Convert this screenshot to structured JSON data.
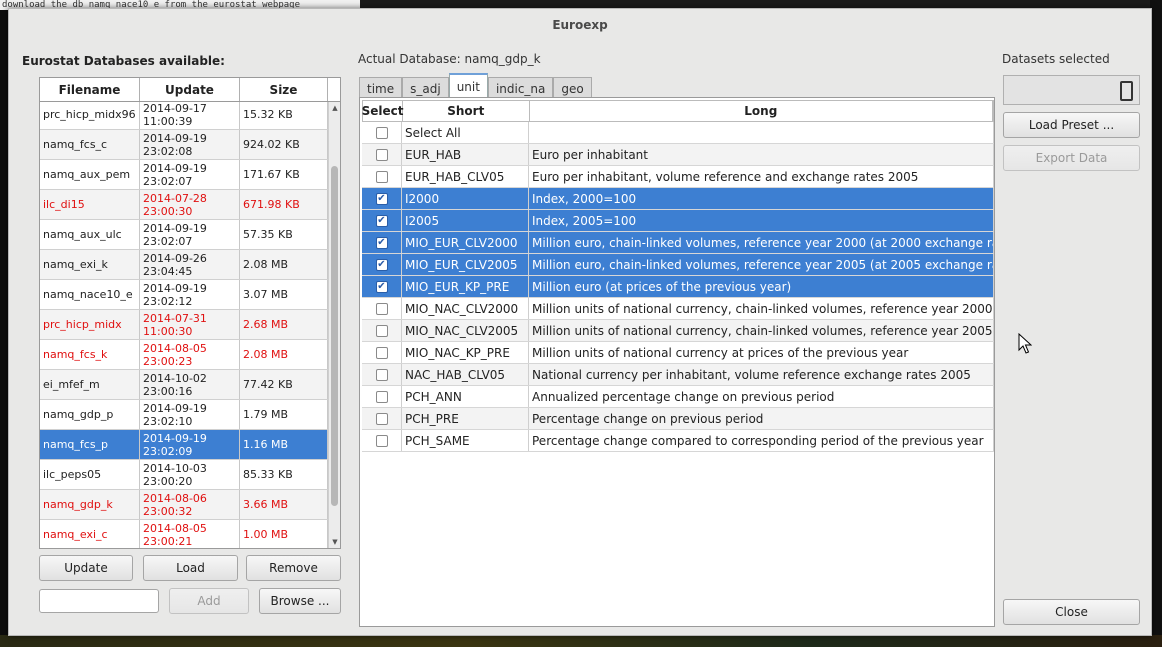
{
  "background": {
    "terminal_line": "download the db namq_nace10_e from the eurostat webpage"
  },
  "window": {
    "title": "Euroexp"
  },
  "left_panel": {
    "heading": "Eurostat Databases available:",
    "columns": [
      "Filename",
      "Update",
      "Size"
    ],
    "rows": [
      {
        "name": "prc_hicp_midx96",
        "date": "2014-09-17",
        "time": "11:00:39",
        "size": "15.32 KB",
        "state": "normal"
      },
      {
        "name": "namq_fcs_c",
        "date": "2014-09-19",
        "time": "23:02:08",
        "size": "924.02 KB",
        "state": "normal"
      },
      {
        "name": "namq_aux_pem",
        "date": "2014-09-19",
        "time": "23:02:07",
        "size": "171.67 KB",
        "state": "normal"
      },
      {
        "name": "ilc_di15",
        "date": "2014-07-28",
        "time": "23:00:30",
        "size": "671.98 KB",
        "state": "red"
      },
      {
        "name": "namq_aux_ulc",
        "date": "2014-09-19",
        "time": "23:02:07",
        "size": "57.35 KB",
        "state": "normal"
      },
      {
        "name": "namq_exi_k",
        "date": "2014-09-26",
        "time": "23:04:45",
        "size": "2.08 MB",
        "state": "normal"
      },
      {
        "name": "namq_nace10_e",
        "date": "2014-09-19",
        "time": "23:02:12",
        "size": "3.07 MB",
        "state": "normal"
      },
      {
        "name": "prc_hicp_midx",
        "date": "2014-07-31",
        "time": "11:00:30",
        "size": "2.68 MB",
        "state": "red"
      },
      {
        "name": "namq_fcs_k",
        "date": "2014-08-05",
        "time": "23:00:23",
        "size": "2.08 MB",
        "state": "red"
      },
      {
        "name": "ei_mfef_m",
        "date": "2014-10-02",
        "time": "23:00:16",
        "size": "77.42 KB",
        "state": "normal"
      },
      {
        "name": "namq_gdp_p",
        "date": "2014-09-19",
        "time": "23:02:10",
        "size": "1.79 MB",
        "state": "normal"
      },
      {
        "name": "namq_fcs_p",
        "date": "2014-09-19",
        "time": "23:02:09",
        "size": "1.16 MB",
        "state": "selected"
      },
      {
        "name": "ilc_peps05",
        "date": "2014-10-03",
        "time": "23:00:20",
        "size": "85.33 KB",
        "state": "normal"
      },
      {
        "name": "namq_gdp_k",
        "date": "2014-08-06",
        "time": "23:00:32",
        "size": "3.66 MB",
        "state": "red"
      },
      {
        "name": "namq_exi_c",
        "date": "2014-08-05",
        "time": "23:00:21",
        "size": "1.00 MB",
        "state": "red"
      }
    ],
    "buttons": {
      "update": "Update",
      "load": "Load",
      "remove": "Remove",
      "add": "Add",
      "browse": "Browse ..."
    },
    "path_input_value": ""
  },
  "center_panel": {
    "actual_db_label": "Actual Database: namq_gdp_k",
    "tabs": [
      {
        "label": "time",
        "active": false
      },
      {
        "label": "s_adj",
        "active": false
      },
      {
        "label": "unit",
        "active": true
      },
      {
        "label": "indic_na",
        "active": false
      },
      {
        "label": "geo",
        "active": false
      }
    ],
    "columns": [
      "Select",
      "Short",
      "Long"
    ],
    "rows": [
      {
        "short": "Select All",
        "long": "",
        "checked": false
      },
      {
        "short": "EUR_HAB",
        "long": "Euro per inhabitant",
        "checked": false
      },
      {
        "short": "EUR_HAB_CLV05",
        "long": "Euro per inhabitant, volume reference and exchange rates 2005",
        "checked": false
      },
      {
        "short": "I2000",
        "long": "Index, 2000=100",
        "checked": true
      },
      {
        "short": "I2005",
        "long": "Index, 2005=100",
        "checked": true
      },
      {
        "short": "MIO_EUR_CLV2000",
        "long": "Million euro, chain-linked volumes, reference year 2000 (at 2000 exchange rates)",
        "checked": true
      },
      {
        "short": "MIO_EUR_CLV2005",
        "long": "Million euro, chain-linked volumes, reference year 2005 (at 2005 exchange rates)",
        "checked": true
      },
      {
        "short": "MIO_EUR_KP_PRE",
        "long": "Million euro (at prices of the previous year)",
        "checked": true
      },
      {
        "short": "MIO_NAC_CLV2000",
        "long": "Million units of national currency, chain-linked volumes, reference year 2000",
        "checked": false
      },
      {
        "short": "MIO_NAC_CLV2005",
        "long": "Million units of national currency, chain-linked volumes, reference year 2005",
        "checked": false
      },
      {
        "short": "MIO_NAC_KP_PRE",
        "long": "Million units of national currency at prices of the previous year",
        "checked": false
      },
      {
        "short": "NAC_HAB_CLV05",
        "long": "National currency per inhabitant, volume reference exchange rates 2005",
        "checked": false
      },
      {
        "short": "PCH_ANN",
        "long": "Annualized percentage change on previous period",
        "checked": false
      },
      {
        "short": "PCH_PRE",
        "long": "Percentage change on previous period",
        "checked": false
      },
      {
        "short": "PCH_SAME",
        "long": "Percentage change compared to corresponding period of the previous year",
        "checked": false
      }
    ]
  },
  "right_panel": {
    "datasets_label": "Datasets selected",
    "datasets_count": "0",
    "buttons": {
      "load_preset": "Load Preset ...",
      "export_data": "Export Data",
      "close": "Close"
    }
  },
  "colors": {
    "selection": "#3d7fd2",
    "stale_text": "#e01010",
    "window_bg": "#e8e8e7"
  },
  "icons": {
    "checkbox_checked": "check-icon",
    "cursor": "mouse-pointer-icon",
    "scroll_up": "chevron-up-icon",
    "scroll_down": "chevron-down-icon"
  }
}
